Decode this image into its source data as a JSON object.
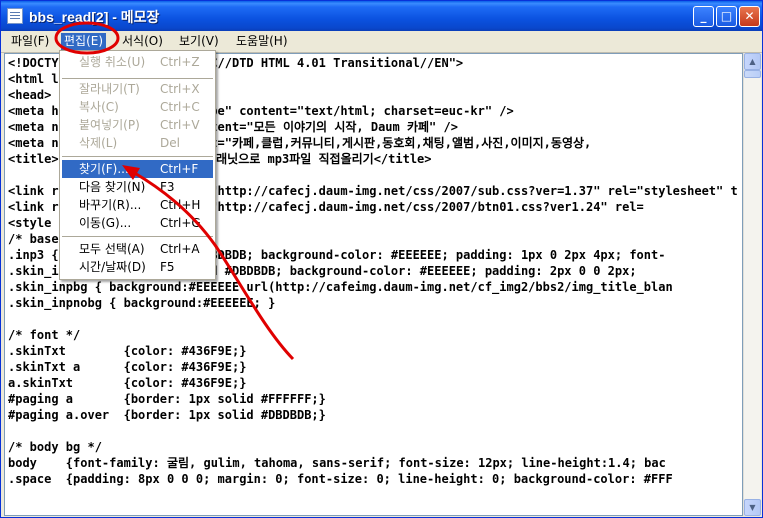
{
  "window": {
    "title": "bbs_read[2] - 메모장",
    "buttons": {
      "minimize": "_",
      "maximize": "□",
      "close": "✕"
    }
  },
  "menubar": {
    "items": [
      {
        "label": "파일(F)"
      },
      {
        "label": "편집(E)"
      },
      {
        "label": "서식(O)"
      },
      {
        "label": "보기(V)"
      },
      {
        "label": "도움말(H)"
      }
    ]
  },
  "edit_menu": {
    "items": [
      {
        "label": "실행 취소(U)",
        "shortcut": "Ctrl+Z",
        "enabled": false
      },
      {
        "label": "잘라내기(T)",
        "shortcut": "Ctrl+X",
        "enabled": false
      },
      {
        "label": "복사(C)",
        "shortcut": "Ctrl+C",
        "enabled": false
      },
      {
        "label": "붙여넣기(P)",
        "shortcut": "Ctrl+V",
        "enabled": false
      },
      {
        "label": "삭제(L)",
        "shortcut": "Del",
        "enabled": false
      },
      {
        "label": "찾기(F)...",
        "shortcut": "Ctrl+F",
        "enabled": true,
        "highlighted": true
      },
      {
        "label": "다음 찾기(N)",
        "shortcut": "F3",
        "enabled": true
      },
      {
        "label": "바꾸기(R)...",
        "shortcut": "Ctrl+H",
        "enabled": true
      },
      {
        "label": "이동(G)...",
        "shortcut": "Ctrl+G",
        "enabled": true
      },
      {
        "label": "모두 선택(A)",
        "shortcut": "Ctrl+A",
        "enabled": true
      },
      {
        "label": "시간/날짜(D)",
        "shortcut": "F5",
        "enabled": true
      }
    ]
  },
  "editor": {
    "lines": [
      "<!DOCTYPE HTML PUBLIC \"-//W3C//DTD HTML 4.01 Transitional//EN\">",
      "<html lang=\"ko\">",
      "<head>",
      "<meta http-equiv=\"Content-Type\" content=\"text/html; charset=euc-kr\" />",
      "<meta name=\"description\" content=\"모든 이야기의 시작, Daum 카페\" />",
      "<meta name=\"keywords\" content=\"카페,클럽,커뮤니티,게시판,동호회,채팅,앨범,사진,이미지,동영상,",
      "<title>네이버 블로그 강좌학교 - 플래닛으로 mp3파일 직접올리기</title>",
      "",
      "<link rel=\"stylesheet\" href=\"http://cafecj.daum-img.net/css/2007/sub.css?ver=1.37\" rel=\"stylesheet\" t",
      "<link rel=\"stylesheet\" href=\"http://cafecj.daum-img.net/css/2007/btn01.css?ver1.24\" rel=",
      "<style type=\"text/css\">",
      "/* base */",
      ".inp3 { border: 1px solid #DBDBDB; background-color: #EEEEEE; padding: 1px 0 2px 4px; font-",
      ".skin_inp { border: 1px solid #DBDBDB; background-color: #EEEEEE; padding: 2px 0 0 2px;",
      ".skin_inpbg { background:#EEEEEE url(http://cafeimg.daum-img.net/cf_img2/bbs2/img_title_blan",
      ".skin_inpnobg { background:#EEEEEE; }",
      "",
      "/* font */",
      ".skinTxt        {color: #436F9E;}",
      ".skinTxt a      {color: #436F9E;}",
      "a.skinTxt       {color: #436F9E;}",
      "#paging a       {border: 1px solid #FFFFFF;}",
      "#paging a.over  {border: 1px solid #DBDBDB;}",
      "",
      "/* body bg */",
      "body    {font-family: 굴림, gulim, tahoma, sans-serif; font-size: 12px; line-height:1.4; bac",
      ".space  {padding: 8px 0 0 0; margin: 0; font-size: 0; line-height: 0; background-color: #FFF"
    ]
  },
  "scrollbar": {
    "up_icon": "▲",
    "down_icon": "▼"
  },
  "annotation": {
    "color": "#e00000"
  }
}
